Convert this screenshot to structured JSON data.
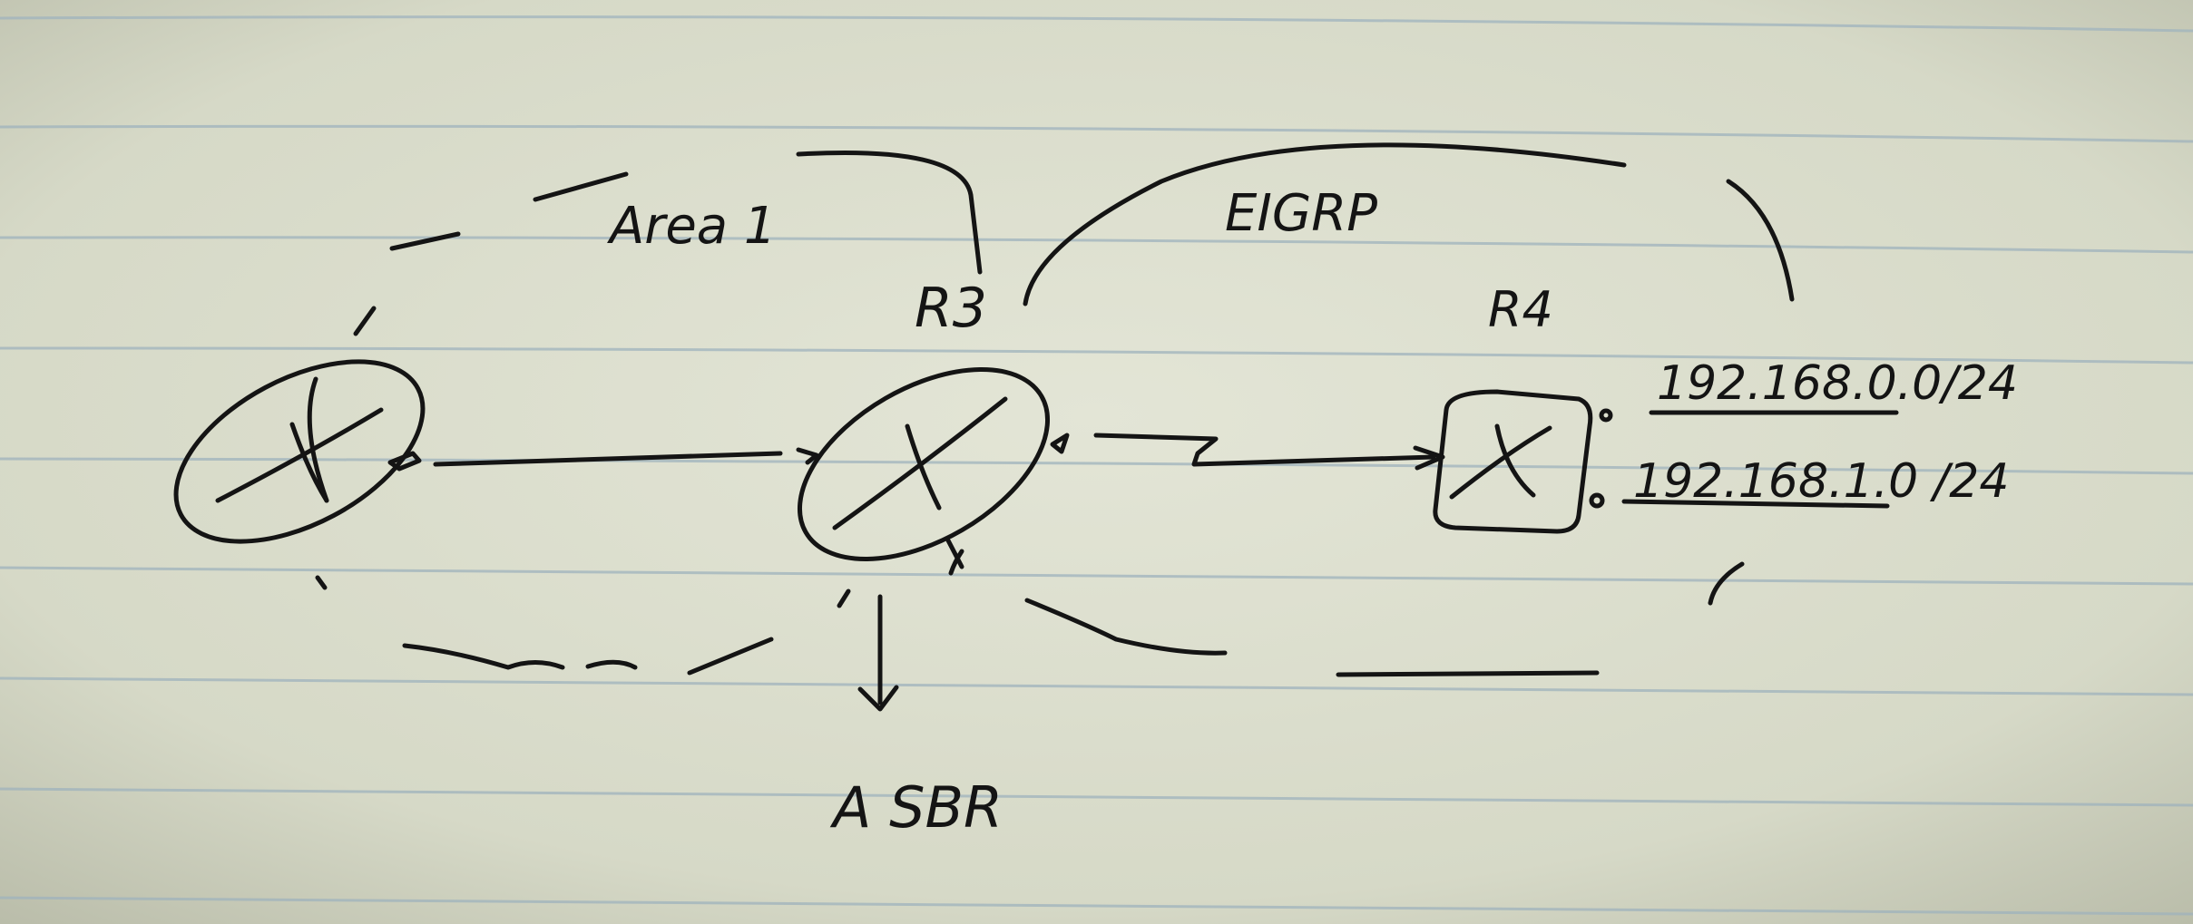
{
  "diagram": {
    "area_label": "Area 1",
    "protocol_label": "EIGRP",
    "router_r3_label": "R3",
    "router_r4_label": "R4",
    "asbr_label": "A SBR",
    "networks": [
      "192.168.0.0/24",
      "192.168.1.0 /24"
    ]
  },
  "colors": {
    "paper": "#d9dccb",
    "rule_line": "#9fb3bd",
    "ink": "#141414"
  },
  "icons": [
    "router-icon",
    "arrow-icon"
  ]
}
